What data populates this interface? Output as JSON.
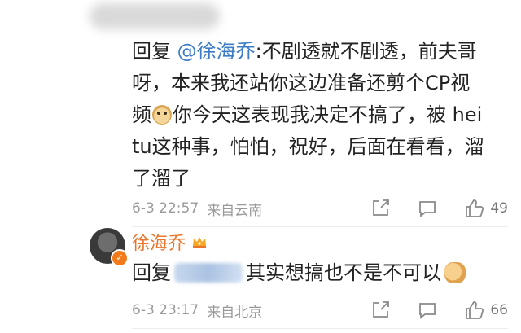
{
  "comment1": {
    "reply_prefix": "回复",
    "mention": "@徐海乔",
    "text_1": ":不剧透就不剧透，前夫哥",
    "text_2": "呀，本来我还站你这边准备还剪个CP视",
    "text_3a": "频",
    "text_3b": "你今天这表现我决定不搞了，被 hei",
    "text_4": "tu这种事，怕怕，祝好，后面在看看，溜",
    "text_5": "了溜了",
    "time": "6-3 22:57",
    "location": "来自云南",
    "likes": "49"
  },
  "comment2": {
    "username": "徐海乔",
    "reply_prefix": "回复",
    "text": "其实想搞也不是不可以",
    "time": "6-3 23:17",
    "location": "来自北京",
    "likes": "66"
  },
  "icons": {
    "share": "share-icon",
    "comment": "comment-icon",
    "like": "thumbs-up-icon"
  },
  "colors": {
    "mention": "#3c7cc6",
    "username": "#e8762c",
    "meta": "#9a9a9a"
  }
}
